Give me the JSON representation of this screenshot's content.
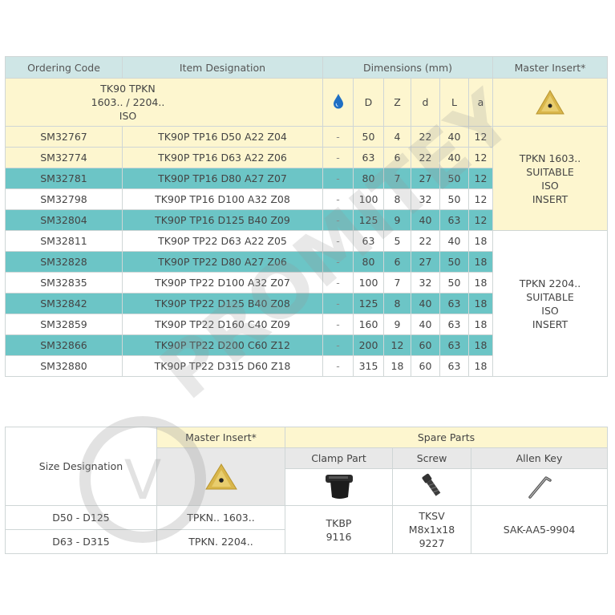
{
  "main": {
    "headers": {
      "ordering_code": "Ordering Code",
      "item_designation": "Item Designation",
      "dimensions": "Dimensions (mm)",
      "master_insert": "Master Insert*"
    },
    "subheader": {
      "designation_line1": "TK90 TPKN",
      "designation_line2": "1603.. / 2204..",
      "designation_line3": "ISO",
      "coolant_icon": "water-drop-icon",
      "cols": [
        "D",
        "Z",
        "d",
        "L",
        "a"
      ]
    },
    "rows": [
      {
        "code": "SM32767",
        "designation": "TK90P TP16 D50 A22 Z04",
        "coolant": "-",
        "D": "50",
        "Z": "4",
        "d": "22",
        "L": "40",
        "a": "12"
      },
      {
        "code": "SM32774",
        "designation": "TK90P TP16 D63 A22 Z06",
        "coolant": "-",
        "D": "63",
        "Z": "6",
        "d": "22",
        "L": "40",
        "a": "12"
      },
      {
        "code": "SM32781",
        "designation": "TK90P TP16 D80 A27 Z07",
        "coolant": "-",
        "D": "80",
        "Z": "7",
        "d": "27",
        "L": "50",
        "a": "12"
      },
      {
        "code": "SM32798",
        "designation": "TK90P TP16 D100 A32 Z08",
        "coolant": "-",
        "D": "100",
        "Z": "8",
        "d": "32",
        "L": "50",
        "a": "12"
      },
      {
        "code": "SM32804",
        "designation": "TK90P TP16 D125 B40 Z09",
        "coolant": "-",
        "D": "125",
        "Z": "9",
        "d": "40",
        "L": "63",
        "a": "12"
      },
      {
        "code": "SM32811",
        "designation": "TK90P TP22 D63 A22 Z05",
        "coolant": "-",
        "D": "63",
        "Z": "5",
        "d": "22",
        "L": "40",
        "a": "18"
      },
      {
        "code": "SM32828",
        "designation": "TK90P TP22 D80 A27 Z06",
        "coolant": "-",
        "D": "80",
        "Z": "6",
        "d": "27",
        "L": "50",
        "a": "18"
      },
      {
        "code": "SM32835",
        "designation": "TK90P TP22 D100 A32 Z07",
        "coolant": "-",
        "D": "100",
        "Z": "7",
        "d": "32",
        "L": "50",
        "a": "18"
      },
      {
        "code": "SM32842",
        "designation": "TK90P TP22 D125 B40 Z08",
        "coolant": "-",
        "D": "125",
        "Z": "8",
        "d": "40",
        "L": "63",
        "a": "18"
      },
      {
        "code": "SM32859",
        "designation": "TK90P TP22 D160 C40 Z09",
        "coolant": "-",
        "D": "160",
        "Z": "9",
        "d": "40",
        "L": "63",
        "a": "18"
      },
      {
        "code": "SM32866",
        "designation": "TK90P TP22 D200 C60 Z12",
        "coolant": "-",
        "D": "200",
        "Z": "12",
        "d": "60",
        "L": "63",
        "a": "18"
      },
      {
        "code": "SM32880",
        "designation": "TK90P TP22 D315 D60 Z18",
        "coolant": "-",
        "D": "315",
        "Z": "18",
        "d": "60",
        "L": "63",
        "a": "18"
      }
    ],
    "insert_group_1": {
      "line1": "TPKN 1603..",
      "line2": "SUITABLE",
      "line3": "ISO",
      "line4": "INSERT"
    },
    "insert_group_2": {
      "line1": "TPKN 2204..",
      "line2": "SUITABLE",
      "line3": "ISO",
      "line4": "INSERT"
    }
  },
  "spare": {
    "size_designation": "Size Designation",
    "master_insert": "Master Insert*",
    "spare_parts": "Spare Parts",
    "clamp_part": "Clamp Part",
    "screw": "Screw",
    "allen_key": "Allen Key",
    "rows": [
      {
        "size": "D50 - D125",
        "insert": "TPKN.. 1603.."
      },
      {
        "size": "D63 - D315",
        "insert": "TPKN. 2204.."
      }
    ],
    "clamp_line1": "TKBP",
    "clamp_line2": "9116",
    "screw_line1": "TKSV",
    "screw_line2": "M8x1x18",
    "screw_line3": "9227",
    "allen_value": "SAK-AA5-9904"
  },
  "watermark": {
    "text": "PROMITEY",
    "symbol": "V"
  },
  "colors": {
    "header": "#cfe6e6",
    "yellow": "#fdf6cf",
    "teal": "#6cc5c6",
    "border": "#cfd6d6"
  }
}
